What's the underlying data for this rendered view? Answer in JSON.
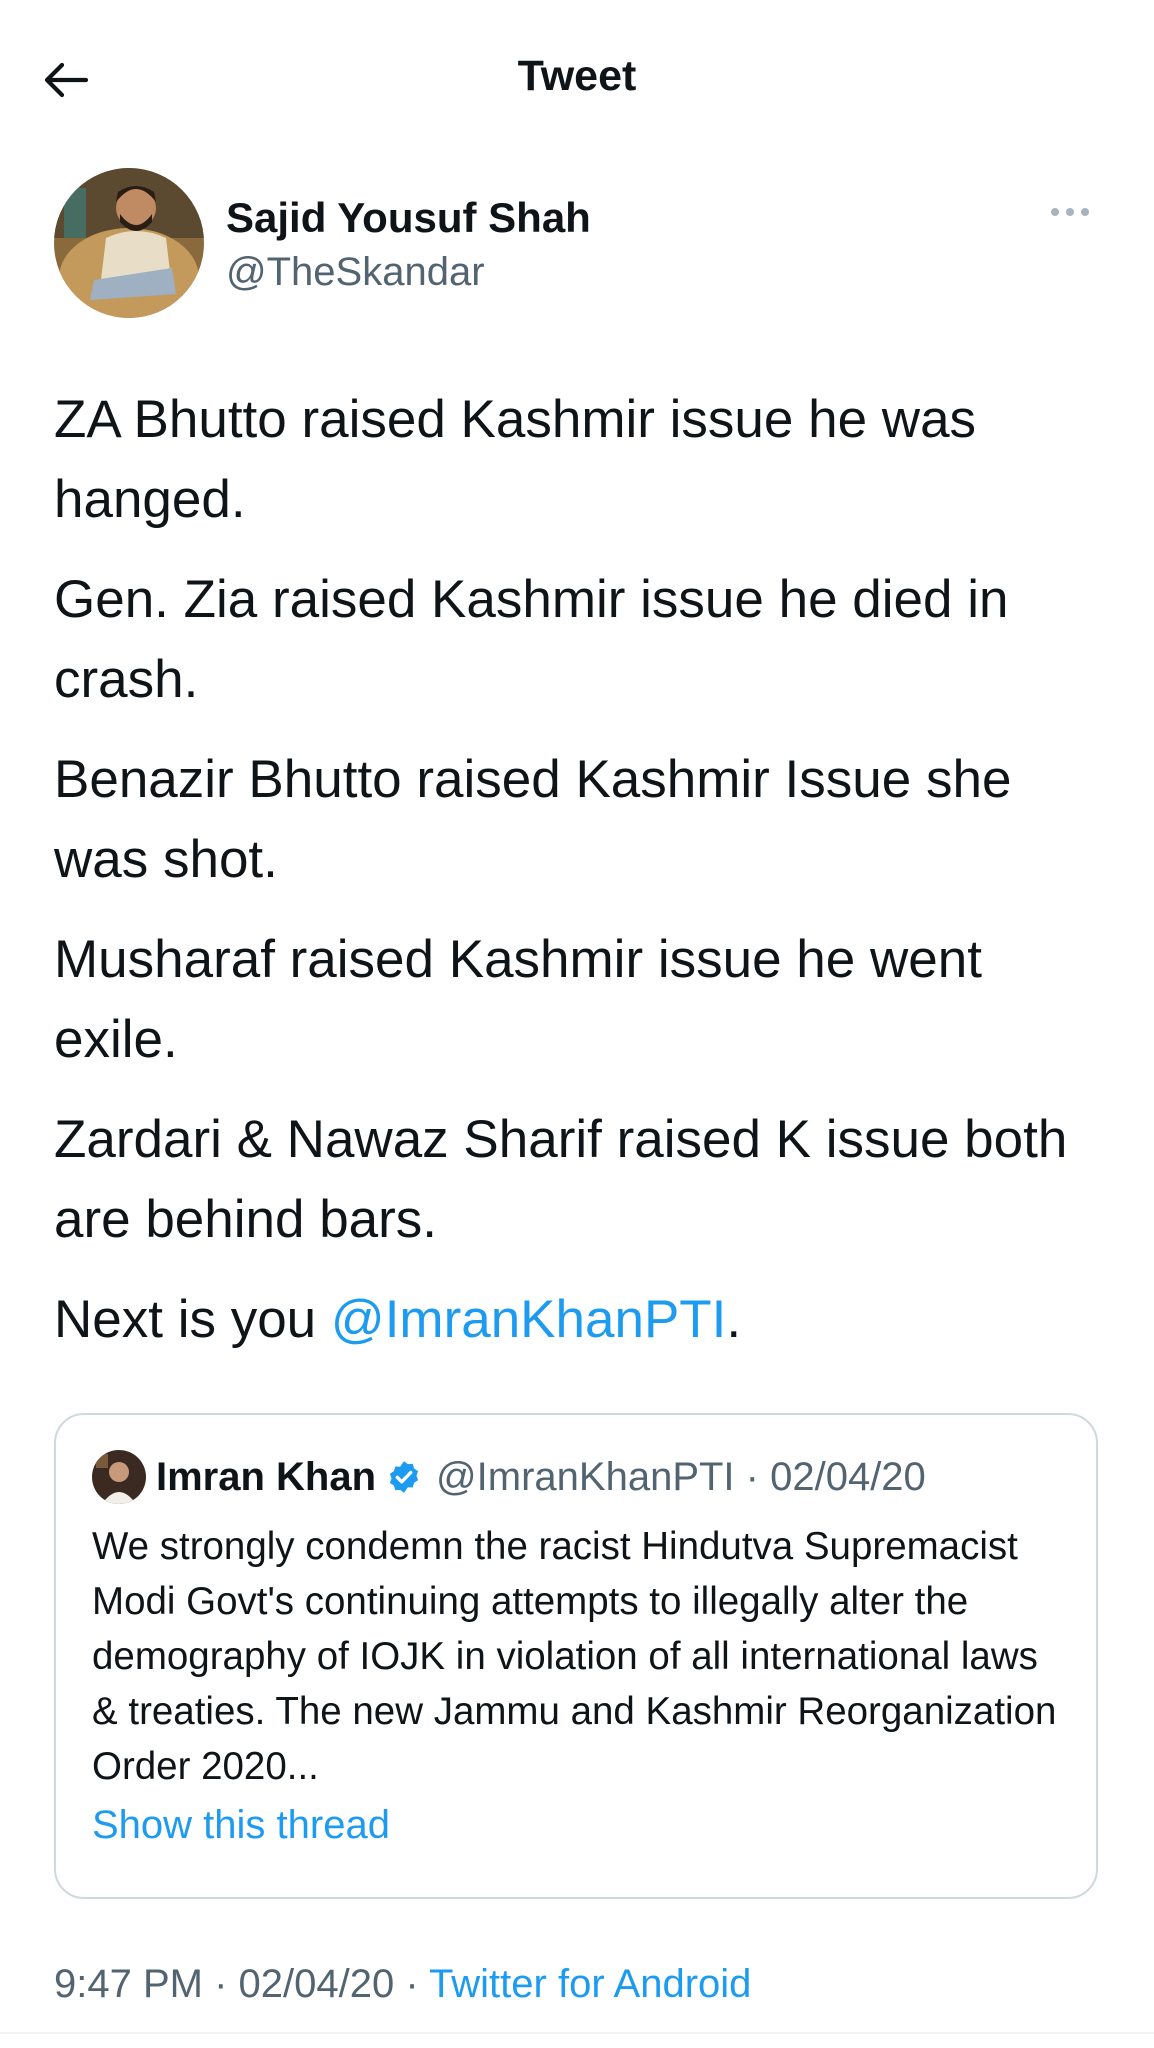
{
  "header": {
    "title": "Tweet",
    "back_icon": "arrow-left-icon"
  },
  "author": {
    "name": "Sajid Yousuf Shah",
    "handle": "@TheSkandar",
    "more_icon": "more-horizontal-icon"
  },
  "tweet": {
    "lines": [
      "ZA Bhutto raised Kashmir issue he was hanged.",
      "Gen. Zia raised Kashmir issue he died in crash.",
      "Benazir Bhutto raised Kashmir Issue she was shot.",
      "Musharaf raised Kashmir issue he went exile.",
      "Zardari & Nawaz Sharif raised K issue both are behind bars."
    ],
    "last_line_prefix": "Next is you ",
    "mention": "@ImranKhanPTI",
    "last_line_suffix": "."
  },
  "quoted": {
    "name": "Imran Khan",
    "handle_date": "@ImranKhanPTI · 02/04/20",
    "verified_icon": "verified-badge-icon",
    "text": "We strongly condemn the racist Hindutva Supremacist Modi Govt's continuing attempts to illegally alter the demography of IOJK in violation of all international laws & treaties. The new Jammu and Kashmir Reorganization Order 2020...",
    "show_thread": "Show this thread"
  },
  "meta": {
    "timestamp": "9:47 PM · 02/04/20 · ",
    "source": "Twitter for Android"
  },
  "colors": {
    "link": "#1d9bf0",
    "secondary": "#536471",
    "text": "#0f1419",
    "border": "#cfd9de"
  }
}
